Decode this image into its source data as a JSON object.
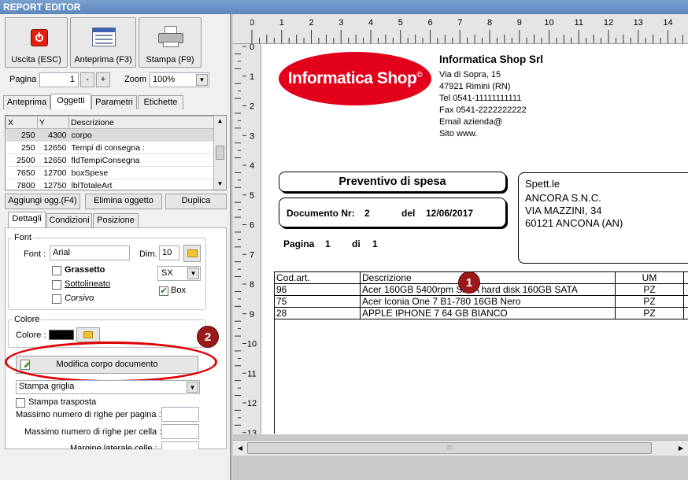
{
  "window": {
    "title": "REPORT EDITOR"
  },
  "toolbar": {
    "exit_label": "Uscita (ESC)",
    "preview_label": "Anteprima (F3)",
    "print_label": "Stampa (F9)",
    "page_label": "Pagina",
    "page_value": "1",
    "minus_label": "-",
    "plus_label": "+",
    "zoom_label": "Zoom",
    "zoom_value": "100%"
  },
  "tabs": [
    "Anteprima",
    "Oggetti",
    "Parametri",
    "Etichette"
  ],
  "objects_table": {
    "headers": [
      "X",
      "Y",
      "Descrizione"
    ],
    "rows": [
      {
        "x": "250",
        "y": "4300",
        "desc": "corpo"
      },
      {
        "x": "250",
        "y": "12650",
        "desc": "Tempi di consegna :"
      },
      {
        "x": "2500",
        "y": "12650",
        "desc": "fldTempiConsegna"
      },
      {
        "x": "7650",
        "y": "12700",
        "desc": "boxSpese"
      },
      {
        "x": "7800",
        "y": "12750",
        "desc": "lblTotaleArt"
      }
    ]
  },
  "object_buttons": {
    "add": "Aggiungi ogg.(F4)",
    "delete": "Elimina oggetto",
    "duplicate": "Duplica"
  },
  "subtabs": [
    "Dettagli",
    "Condizioni",
    "Posizione"
  ],
  "font_group": {
    "title": "Font",
    "font_label": "Font :",
    "font_value": "Arial",
    "dim_label": "Dim.",
    "dim_value": "10",
    "bold_label": "Grassetto",
    "underline_label": "Sottolineato",
    "italic_label": "Corsivo",
    "align_value": "SX",
    "box_label": "Box"
  },
  "color_group": {
    "title": "Colore",
    "color_label": "Colore :",
    "color_value": "#000000"
  },
  "modify_button": "Modifica corpo documento",
  "grid_select": "Stampa griglia",
  "transposed_label": "Stampa trasposta",
  "max_rows_page_label": "Massimo numero di righe per pagina :",
  "max_rows_cell_label": "Massimo numero di righe per cella :",
  "margin_label": "Margine laterale celle :",
  "annotations": {
    "one": "1",
    "two": "2"
  },
  "ruler": {
    "top": [
      "0",
      "1",
      "2",
      "3",
      "4",
      "5",
      "6",
      "7",
      "8",
      "9",
      "10",
      "11",
      "12",
      "13",
      "14"
    ],
    "left": [
      "0",
      "1",
      "2",
      "3",
      "4",
      "5",
      "6",
      "7",
      "8",
      "9",
      "10",
      "11",
      "12",
      "13"
    ]
  },
  "report": {
    "logo_text": "Informatica Shop",
    "logo_mark": "©",
    "company_name": "Informatica Shop Srl",
    "company_lines": [
      "Via di Sopra, 15",
      "47921 Rimini (RN)",
      "Tel 0541-11111111111",
      "Fax 0541-2222222222",
      "Email azienda@",
      "Sito www."
    ],
    "doc_title": "Preventivo di spesa",
    "doc_number_label": "Documento Nr:",
    "doc_number": "2",
    "doc_date_label": "del",
    "doc_date": "12/06/2017",
    "page_label": "Pagina",
    "page_num": "1",
    "of_label": "di",
    "page_total": "1",
    "recipient_lines": [
      "Spett.le",
      "ANCORA S.N.C.",
      "VIA MAZZINI, 34",
      "60121 ANCONA (AN)"
    ],
    "items_headers": [
      "Cod.art.",
      "Descrizione",
      "UM"
    ],
    "items": [
      {
        "code": "96",
        "desc": "Acer 160GB 5400rpm SATA hard disk 160GB SATA",
        "um": "PZ"
      },
      {
        "code": "75",
        "desc": "Acer Iconia One 7 B1-780 16GB Nero",
        "um": "PZ"
      },
      {
        "code": "28",
        "desc": "APPLE IPHONE 7 64 GB BIANCO",
        "um": "PZ"
      }
    ]
  },
  "colors": {
    "accent_red": "#e3001b",
    "badge": "#9a1a1a",
    "highlight": "#e00000"
  }
}
